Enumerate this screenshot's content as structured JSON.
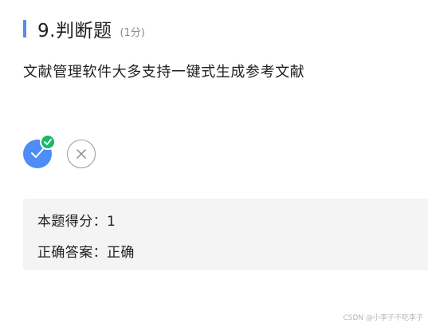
{
  "question": {
    "title": "9.判断题",
    "score": "(1分)",
    "stem": "文献管理软件大多支持一键式生成参考文献"
  },
  "options": {
    "true_icon": "check-icon",
    "false_icon": "close-icon",
    "selected": "true"
  },
  "result": {
    "score_line": "本题得分：1",
    "answer_line": "正确答案：正确"
  },
  "watermark": "CSDN @小李子不吃李子",
  "colors": {
    "accent": "#4e8df5",
    "selected_badge": "#19b86b",
    "result_bg": "#f4f4f4"
  }
}
